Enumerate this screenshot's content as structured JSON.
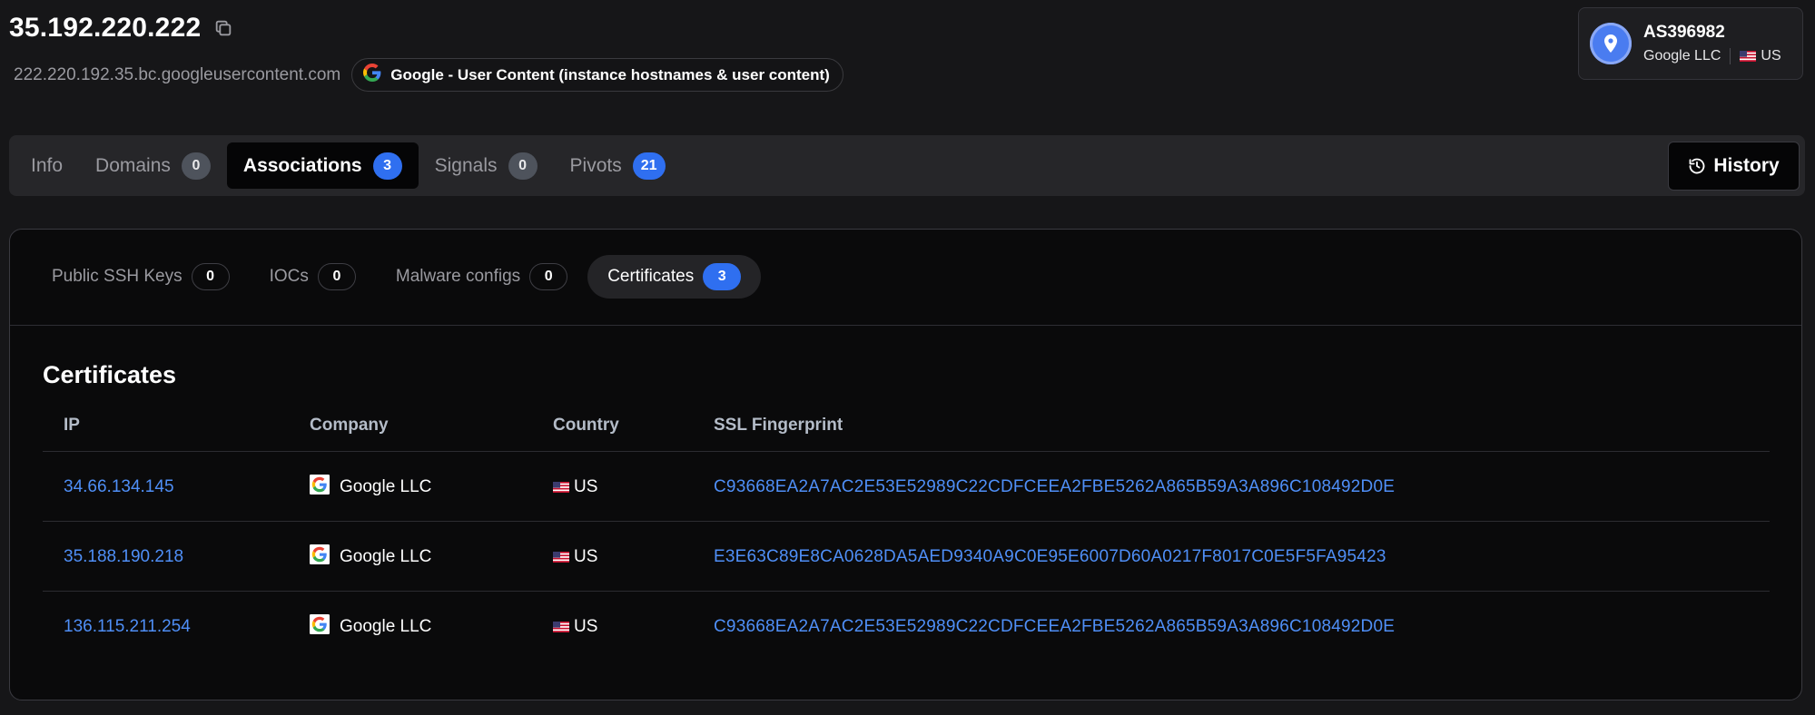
{
  "header": {
    "ip": "35.192.220.222",
    "hostname": "222.220.192.35.bc.googleusercontent.com",
    "provider_tag": "Google -  User Content (instance hostnames & user content)"
  },
  "asn": {
    "number": "AS396982",
    "org": "Google LLC",
    "country": "US"
  },
  "tabs": [
    {
      "label": "Info",
      "count": null
    },
    {
      "label": "Domains",
      "count": "0"
    },
    {
      "label": "Associations",
      "count": "3"
    },
    {
      "label": "Signals",
      "count": "0"
    },
    {
      "label": "Pivots",
      "count": "21"
    }
  ],
  "history_label": "History",
  "subtabs": [
    {
      "label": "Public SSH Keys",
      "count": "0"
    },
    {
      "label": "IOCs",
      "count": "0"
    },
    {
      "label": "Malware configs",
      "count": "0"
    },
    {
      "label": "Certificates",
      "count": "3"
    }
  ],
  "certificates": {
    "title": "Certificates",
    "columns": {
      "ip": "IP",
      "company": "Company",
      "country": "Country",
      "fingerprint": "SSL Fingerprint"
    },
    "rows": [
      {
        "ip": "34.66.134.145",
        "company": "Google LLC",
        "country": "US",
        "fingerprint": "C93668EA2A7AC2E53E52989C22CDFCEEA2FBE5262A865B59A3A896C108492D0E"
      },
      {
        "ip": "35.188.190.218",
        "company": "Google LLC",
        "country": "US",
        "fingerprint": "E3E63C89E8CA0628DA5AED9340A9C0E95E6007D60A0217F8017C0E5F5FA95423"
      },
      {
        "ip": "136.115.211.254",
        "company": "Google LLC",
        "country": "US",
        "fingerprint": "C93668EA2A7AC2E53E52989C22CDFCEEA2FBE5262A865B59A3A896C108492D0E"
      }
    ]
  },
  "colors": {
    "accent_blue": "#2f6ff0",
    "link_blue": "#4f8ff7",
    "background": "#161618"
  },
  "icons": {
    "copy": "copy-icon",
    "google": "google-logo-icon",
    "asn": "location-pin-icon",
    "flag": "us-flag-icon",
    "history": "history-icon"
  }
}
